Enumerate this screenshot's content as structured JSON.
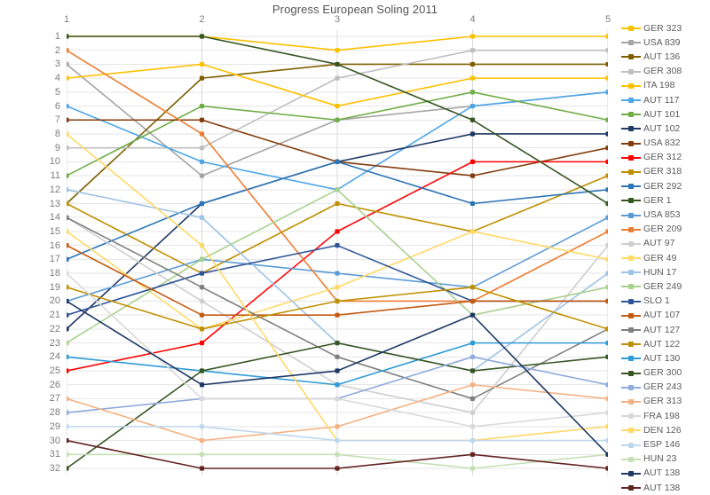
{
  "chart": {
    "title": "Progress European Soling 2011",
    "type": "line",
    "xlabel": "",
    "ylabel": "",
    "x_ticks": [
      1,
      2,
      3,
      4,
      5
    ],
    "y_ticks": [
      1,
      2,
      3,
      4,
      5,
      6,
      7,
      8,
      9,
      10,
      11,
      12,
      13,
      14,
      15,
      16,
      17,
      18,
      19,
      20,
      21,
      22,
      23,
      24,
      25,
      26,
      27,
      28,
      29,
      30,
      31,
      32
    ],
    "y_inverted": true,
    "ylim": [
      1,
      32
    ],
    "grid": true,
    "legend_position": "right"
  },
  "chart_data": {
    "type": "line",
    "title": "Progress European Soling 2011",
    "xlabel": "",
    "ylabel": "",
    "x": [
      1,
      2,
      3,
      4,
      5
    ],
    "ylim": [
      1,
      32
    ],
    "y_inverted": true,
    "grid": true,
    "legend_position": "right",
    "series": [
      {
        "name": "GER 323",
        "color": "#ffc000",
        "values": [
          1,
          1,
          2,
          1,
          1
        ]
      },
      {
        "name": "USA 839",
        "color": "#a5a5a5",
        "values": [
          3,
          11,
          7,
          6,
          5
        ]
      },
      {
        "name": "AUT 136",
        "color": "#7f6000",
        "values": [
          13,
          4,
          3,
          3,
          3
        ]
      },
      {
        "name": "GER 308",
        "color": "#bfbfbf",
        "values": [
          9,
          9,
          4,
          2,
          2
        ]
      },
      {
        "name": "ITA 198",
        "color": "#ffc000",
        "values": [
          4,
          3,
          6,
          4,
          4
        ]
      },
      {
        "name": "AUT 117",
        "color": "#4ea6e8",
        "values": [
          6,
          10,
          12,
          6,
          5
        ]
      },
      {
        "name": "AUT 101",
        "color": "#70ad47",
        "values": [
          11,
          6,
          7,
          5,
          7
        ]
      },
      {
        "name": "AUT 102",
        "color": "#203864",
        "values": [
          22,
          13,
          10,
          8,
          8
        ]
      },
      {
        "name": "USA 832",
        "color": "#843c0c",
        "values": [
          7,
          7,
          10,
          11,
          9
        ]
      },
      {
        "name": "GER 312",
        "color": "#ff0000",
        "values": [
          25,
          23,
          15,
          10,
          10
        ]
      },
      {
        "name": "GER 318",
        "color": "#bf8f00",
        "values": [
          13,
          18,
          13,
          15,
          11
        ]
      },
      {
        "name": "GER 292",
        "color": "#2e75b6",
        "values": [
          17,
          13,
          10,
          13,
          12
        ]
      },
      {
        "name": "GER 1",
        "color": "#375623",
        "values": [
          1,
          1,
          3,
          7,
          13
        ]
      },
      {
        "name": "USA 853",
        "color": "#5b9bd5",
        "values": [
          20,
          17,
          18,
          19,
          14
        ]
      },
      {
        "name": "GER 209",
        "color": "#ed7d31",
        "values": [
          2,
          8,
          20,
          20,
          15
        ]
      },
      {
        "name": "AUT 97",
        "color": "#d0cece",
        "values": [
          14,
          20,
          26,
          28,
          16
        ]
      },
      {
        "name": "GER 49",
        "color": "#ffd966",
        "values": [
          15,
          22,
          19,
          15,
          17
        ]
      },
      {
        "name": "HUN 17",
        "color": "#9dc3e6",
        "values": [
          12,
          14,
          23,
          25,
          18
        ]
      },
      {
        "name": "GER 249",
        "color": "#a9d18e",
        "values": [
          23,
          17,
          12,
          21,
          19
        ]
      },
      {
        "name": "SLO 1",
        "color": "#2f5597",
        "values": [
          21,
          18,
          16,
          20,
          20
        ]
      },
      {
        "name": "AUT 107",
        "color": "#c55a11",
        "values": [
          16,
          21,
          21,
          20,
          20
        ]
      },
      {
        "name": "AUT 127",
        "color": "#7f7f7f",
        "values": [
          14,
          19,
          24,
          27,
          22
        ]
      },
      {
        "name": "AUT 122",
        "color": "#bf9000",
        "values": [
          19,
          22,
          20,
          19,
          22
        ]
      },
      {
        "name": "AUT 130",
        "color": "#2e9bd6",
        "values": [
          24,
          25,
          26,
          23,
          23
        ]
      },
      {
        "name": "GER 300",
        "color": "#375623",
        "values": [
          32,
          25,
          23,
          25,
          24
        ]
      },
      {
        "name": "GER 243",
        "color": "#8faadc",
        "values": [
          28,
          27,
          27,
          24,
          26
        ]
      },
      {
        "name": "GER 313",
        "color": "#f4b183",
        "values": [
          27,
          30,
          29,
          26,
          27
        ]
      },
      {
        "name": "FRA 198",
        "color": "#d9d9d9",
        "values": [
          18,
          27,
          27,
          29,
          28
        ]
      },
      {
        "name": "DEN 126",
        "color": "#ffd966",
        "values": [
          8,
          16,
          30,
          30,
          29
        ]
      },
      {
        "name": "ESP 146",
        "color": "#bdd7ee",
        "values": [
          29,
          29,
          30,
          30,
          30
        ]
      },
      {
        "name": "HUN 23",
        "color": "#c5e0b4",
        "values": [
          31,
          31,
          31,
          32,
          31
        ]
      },
      {
        "name": "AUT 138",
        "color": "#1f3864",
        "values": [
          20,
          26,
          25,
          21,
          31
        ]
      },
      {
        "name": "AUT 138",
        "color": "#632423",
        "values": [
          30,
          32,
          32,
          31,
          32
        ]
      }
    ]
  },
  "legend": {
    "items": [
      {
        "label": "GER 323",
        "color": "#ffc000"
      },
      {
        "label": "USA 839",
        "color": "#a5a5a5"
      },
      {
        "label": "AUT 136",
        "color": "#7f6000"
      },
      {
        "label": "GER 308",
        "color": "#bfbfbf"
      },
      {
        "label": "ITA 198",
        "color": "#ffc000"
      },
      {
        "label": "AUT 117",
        "color": "#4ea6e8"
      },
      {
        "label": "AUT 101",
        "color": "#70ad47"
      },
      {
        "label": "AUT 102",
        "color": "#203864"
      },
      {
        "label": "USA 832",
        "color": "#843c0c"
      },
      {
        "label": "GER 312",
        "color": "#ff0000"
      },
      {
        "label": "GER 318",
        "color": "#bf8f00"
      },
      {
        "label": "GER 292",
        "color": "#2e75b6"
      },
      {
        "label": "GER 1",
        "color": "#375623"
      },
      {
        "label": "USA 853",
        "color": "#5b9bd5"
      },
      {
        "label": "GER 209",
        "color": "#ed7d31"
      },
      {
        "label": "AUT 97",
        "color": "#d0cece"
      },
      {
        "label": "GER 49",
        "color": "#ffd966"
      },
      {
        "label": "HUN 17",
        "color": "#9dc3e6"
      },
      {
        "label": "GER 249",
        "color": "#a9d18e"
      },
      {
        "label": "SLO 1",
        "color": "#2f5597"
      },
      {
        "label": "AUT 107",
        "color": "#c55a11"
      },
      {
        "label": "AUT 127",
        "color": "#7f7f7f"
      },
      {
        "label": "AUT 122",
        "color": "#bf9000"
      },
      {
        "label": "AUT 130",
        "color": "#2e9bd6"
      },
      {
        "label": "GER 300",
        "color": "#375623"
      },
      {
        "label": "GER 243",
        "color": "#8faadc"
      },
      {
        "label": "GER 313",
        "color": "#f4b183"
      },
      {
        "label": "FRA 198",
        "color": "#d9d9d9"
      },
      {
        "label": "DEN 126",
        "color": "#ffd966"
      },
      {
        "label": "ESP 146",
        "color": "#bdd7ee"
      },
      {
        "label": "HUN 23",
        "color": "#c5e0b4"
      },
      {
        "label": "AUT 138",
        "color": "#1f3864"
      },
      {
        "label": "AUT 138",
        "color": "#632423"
      }
    ]
  },
  "style": {
    "grid_color": "#e6e6e6",
    "axis_color": "#d9d9d9",
    "tick_label_color": "#7c7c7c",
    "title_color": "#555555"
  }
}
